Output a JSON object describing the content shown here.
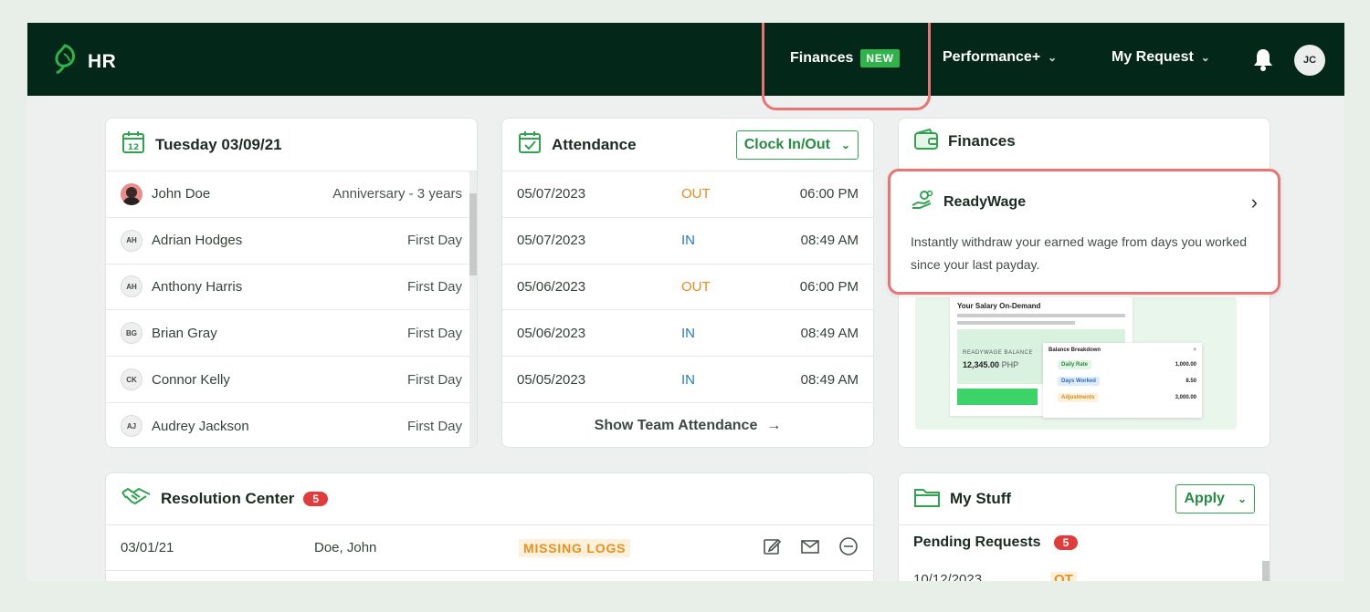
{
  "app": {
    "name": "HR"
  },
  "nav": {
    "finances": "Finances",
    "finances_badge": "NEW",
    "performance": "Performance+",
    "my_request": "My Request",
    "user_initials": "JC"
  },
  "calendar": {
    "date_number": "12",
    "title": "Tuesday 03/09/21",
    "rows": [
      {
        "initials": "",
        "name": "John Doe",
        "note": "Anniversary - 3 years"
      },
      {
        "initials": "AH",
        "name": "Adrian Hodges",
        "note": "First Day"
      },
      {
        "initials": "AH",
        "name": "Anthony Harris",
        "note": "First Day"
      },
      {
        "initials": "BG",
        "name": "Brian Gray",
        "note": "First Day"
      },
      {
        "initials": "CK",
        "name": "Connor Kelly",
        "note": "First Day"
      },
      {
        "initials": "AJ",
        "name": "Audrey Jackson",
        "note": "First Day"
      }
    ]
  },
  "attendance": {
    "title": "Attendance",
    "clock_button": "Clock In/Out",
    "rows": [
      {
        "date": "05/07/2023",
        "status": "OUT",
        "time": "06:00 PM"
      },
      {
        "date": "05/07/2023",
        "status": "IN",
        "time": "08:49 AM"
      },
      {
        "date": "05/06/2023",
        "status": "OUT",
        "time": "06:00 PM"
      },
      {
        "date": "05/06/2023",
        "status": "IN",
        "time": "08:49 AM"
      },
      {
        "date": "05/05/2023",
        "status": "IN",
        "time": "08:49 AM"
      }
    ],
    "show_team": "Show Team Attendance"
  },
  "finances": {
    "title": "Finances",
    "readywage_title": "ReadyWage",
    "readywage_desc": "Instantly withdraw your earned wage from days you worked since your last payday.",
    "preview": {
      "heading": "Your Salary On-Demand",
      "balance_label": "READYWAGE BALANCE",
      "balance_value": "12,345.00",
      "balance_currency": "PHP",
      "breakdown_title": "Balance Breakdown",
      "breakdown_close": "×",
      "breakdown": [
        {
          "label": "Daily Rate",
          "value": "1,000.00"
        },
        {
          "label": "Days Worked",
          "value": "8.50"
        },
        {
          "label": "Adjustments",
          "value": "3,000.00"
        }
      ]
    }
  },
  "resolution": {
    "title": "Resolution Center",
    "count": "5",
    "rows": [
      {
        "date": "03/01/21",
        "name": "Doe, John",
        "status": "MISSING LOGS"
      }
    ]
  },
  "mystuff": {
    "title": "My Stuff",
    "apply_button": "Apply",
    "pending_title": "Pending Requests",
    "pending_count": "5",
    "partial_date": "10/12/2023",
    "partial_type": "OT"
  },
  "colors": {
    "topbar": "#03281a",
    "accent": "#2fb34a",
    "highlight": "#ea7474",
    "out": "#ea8a19",
    "in": "#2579c8",
    "badge": "#e13b3b"
  }
}
